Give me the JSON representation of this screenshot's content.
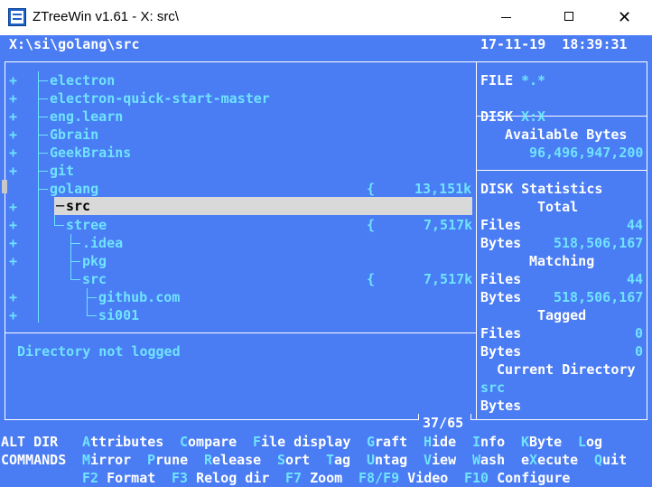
{
  "window": {
    "title": "ZTreeWin v1.61 - X: src\\"
  },
  "header": {
    "path": "X:\\si\\golang\\src",
    "datetime": "17-11-19  18:39:31"
  },
  "tree": {
    "items": [
      {
        "prefix": "+",
        "label": "electron"
      },
      {
        "prefix": "+",
        "label": "electron-quick-start-master"
      },
      {
        "prefix": "+",
        "label": "eng.learn"
      },
      {
        "prefix": "+",
        "label": "Gbrain"
      },
      {
        "prefix": "+",
        "label": "GeekBrains"
      },
      {
        "prefix": "+",
        "label": "git"
      },
      {
        "prefix": "",
        "label": "golang",
        "brace": "{",
        "size": "13,151k"
      },
      {
        "prefix": "+",
        "label": "src"
      },
      {
        "prefix": "+",
        "label": "stree",
        "brace": "{",
        "size": "7,517k"
      },
      {
        "prefix": "+",
        "label": ".idea"
      },
      {
        "prefix": "+",
        "label": "pkg"
      },
      {
        "prefix": "",
        "label": "src",
        "brace": "{",
        "size": "7,517k"
      },
      {
        "prefix": "+",
        "label": "github.com"
      },
      {
        "prefix": "+",
        "label": "si001"
      }
    ],
    "status": "Directory not logged",
    "position": "37/65"
  },
  "side": {
    "file_label": "FILE",
    "file_spec": "*.*",
    "disk_label": "DISK",
    "disk_value": "X:X",
    "available_label": "Available Bytes",
    "available_value": "96,496,947,200",
    "stats_title": "DISK Statistics",
    "total_label": "Total",
    "total_files_label": "Files",
    "total_files": "44",
    "total_bytes_label": "Bytes",
    "total_bytes": "518,506,167",
    "matching_label": "Matching",
    "matching_files_label": "Files",
    "matching_files": "44",
    "matching_bytes_label": "Bytes",
    "matching_bytes": "518,506,167",
    "tagged_label": "Tagged",
    "tagged_files_label": "Files",
    "tagged_files": "0",
    "tagged_bytes_label": "Bytes",
    "tagged_bytes": "0",
    "current_dir_label": "Current Directory",
    "current_dir": "src",
    "current_bytes_label": "Bytes"
  },
  "commands": {
    "row1_label": "ALT DIR",
    "row2_label": "COMMANDS",
    "row1": [
      {
        "key": "A",
        "rest": "ttributes"
      },
      {
        "key": "C",
        "rest": "ompare"
      },
      {
        "key": "F",
        "rest": "ile display"
      },
      {
        "key": "G",
        "rest": "raft"
      },
      {
        "key": "H",
        "rest": "ide"
      },
      {
        "key": "I",
        "rest": "nfo"
      },
      {
        "key": "K",
        "rest": "Byte"
      },
      {
        "key": "L",
        "rest": "og"
      }
    ],
    "row2": [
      {
        "key": "M",
        "rest": "irror"
      },
      {
        "key": "P",
        "rest": "rune"
      },
      {
        "key": "R",
        "rest": "elease"
      },
      {
        "key": "S",
        "rest": "ort"
      },
      {
        "key": "T",
        "rest": "ag"
      },
      {
        "key": "U",
        "rest": "ntag"
      },
      {
        "key": "V",
        "rest": "iew"
      },
      {
        "key": "W",
        "rest": "ash"
      },
      {
        "key": "X",
        "pre": "e",
        "rest": "ecute"
      },
      {
        "key": "Q",
        "rest": "uit"
      }
    ],
    "row3": [
      {
        "key": "F2",
        "rest": " Format"
      },
      {
        "key": "F3",
        "rest": " Relog dir"
      },
      {
        "key": "F7",
        "rest": " Zoom"
      },
      {
        "key": "F8/F9",
        "rest": " Video"
      },
      {
        "key": "F10",
        "rest": " Configure"
      }
    ]
  }
}
